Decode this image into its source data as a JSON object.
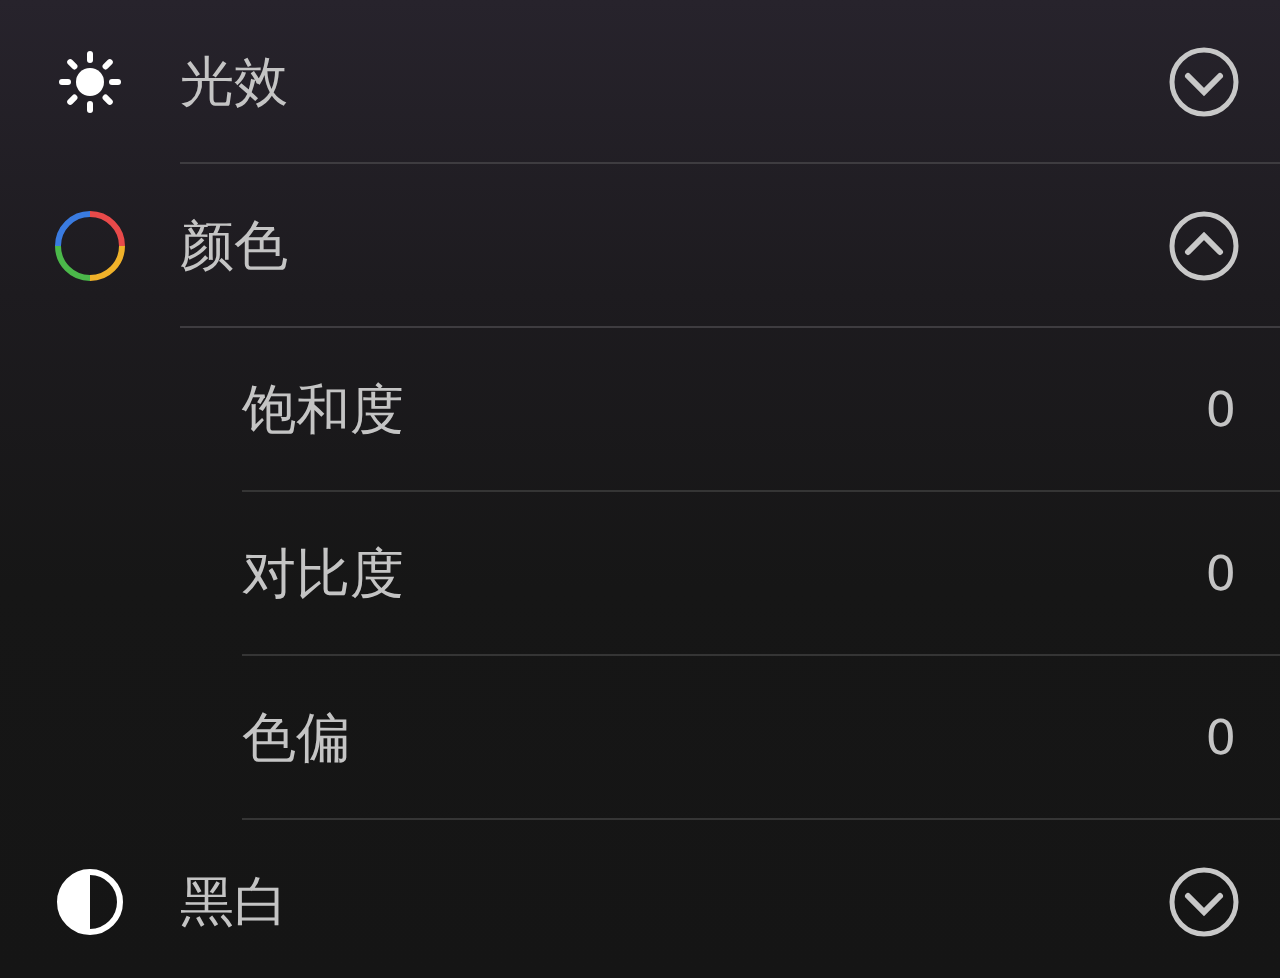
{
  "sections": [
    {
      "kind": "sun",
      "label": "光效",
      "expanded": false
    },
    {
      "kind": "color",
      "label": "颜色",
      "expanded": true,
      "items": [
        {
          "label": "饱和度",
          "value": "0"
        },
        {
          "label": "对比度",
          "value": "0"
        },
        {
          "label": "色偏",
          "value": "0"
        }
      ]
    },
    {
      "kind": "mono",
      "label": "黑白",
      "expanded": false
    }
  ]
}
